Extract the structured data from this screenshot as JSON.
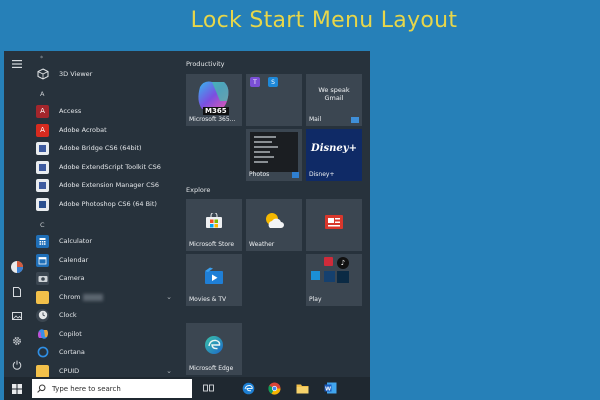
{
  "banner": {
    "title": "Lock Start Menu Layout"
  },
  "applist": {
    "items": [
      {
        "label": "3D Viewer",
        "icon": "cube-icon"
      },
      {
        "label": "A",
        "type": "letter"
      },
      {
        "label": "Access",
        "icon": "access-icon"
      },
      {
        "label": "Adobe Acrobat",
        "icon": "acrobat-icon"
      },
      {
        "label": "Adobe Bridge CS6 (64bit)",
        "icon": "folder-icon"
      },
      {
        "label": "Adobe ExtendScript Toolkit CS6",
        "icon": "folder-icon"
      },
      {
        "label": "Adobe Extension Manager CS6",
        "icon": "folder-icon"
      },
      {
        "label": "Adobe Photoshop CS6 (64 Bit)",
        "icon": "photoshop-icon"
      },
      {
        "label": "C",
        "type": "letter"
      },
      {
        "label": "Calculator",
        "icon": "calculator-icon"
      },
      {
        "label": "Calendar",
        "icon": "calendar-icon"
      },
      {
        "label": "Camera",
        "icon": "camera-icon"
      },
      {
        "label": "Chrom",
        "icon": "folder-icon"
      },
      {
        "label": "Clock",
        "icon": "clock-icon"
      },
      {
        "label": "Copilot",
        "icon": "copilot-icon"
      },
      {
        "label": "Cortana",
        "icon": "cortana-icon"
      },
      {
        "label": "CPUID",
        "icon": "folder-icon"
      }
    ]
  },
  "tiles": {
    "productivity_label": "Productivity",
    "explore_label": "Explore",
    "microsoft365": {
      "label": "Microsoft 365...",
      "badge": "M365"
    },
    "mail": {
      "line1": "We speak",
      "line2": "Gmail",
      "label": "Mail"
    },
    "photos": {
      "label": "Photos"
    },
    "disney": {
      "logo": "Disney+",
      "label": "Disney+"
    },
    "store": {
      "label": "Microsoft Store"
    },
    "weather": {
      "label": "Weather"
    },
    "movies": {
      "label": "Movies & TV"
    },
    "play": {
      "label": "Play"
    },
    "edge": {
      "label": "Microsoft Edge"
    }
  },
  "taskbar": {
    "search_placeholder": "Type here to search"
  },
  "colors": {
    "background": "#2680b8",
    "banner_text": "#e7d64a",
    "menu_bg": "#27323c",
    "tile_bg": "#3b4651"
  }
}
